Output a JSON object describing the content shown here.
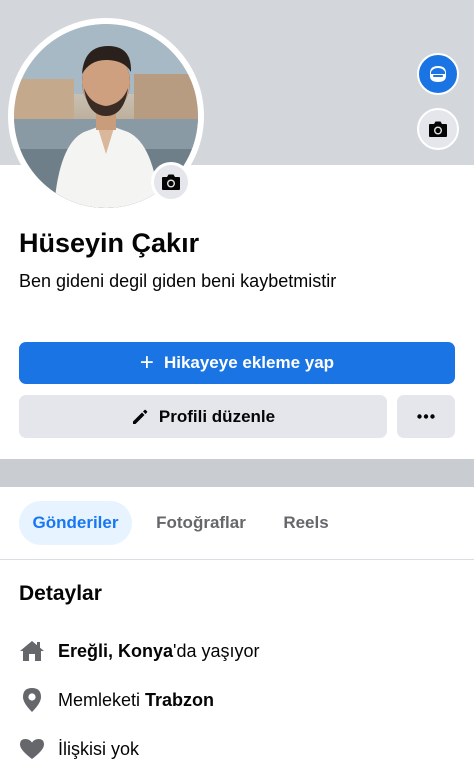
{
  "profile": {
    "name": "Hüseyin Çakır",
    "bio": "Ben gideni degil giden beni kaybetmistir"
  },
  "actions": {
    "add_story_label": "Hikayeye ekleme yap",
    "edit_profile_label": "Profili düzenle"
  },
  "tabs": [
    {
      "label": "Gönderiler",
      "active": true
    },
    {
      "label": "Fotoğraflar",
      "active": false
    },
    {
      "label": "Reels",
      "active": false
    }
  ],
  "details": {
    "title": "Detaylar",
    "lives_in": {
      "place": "Ereğli, Konya",
      "suffix": "'da yaşıyor",
      "icon": "home-icon"
    },
    "hometown": {
      "prefix": "Memleketi ",
      "place": "Trabzon",
      "icon": "location-pin-icon"
    },
    "relationship": {
      "text": "İlişkisi yok",
      "icon": "heart-icon"
    }
  },
  "colors": {
    "accent": "#1b74e4",
    "tab_active_bg": "#e7f3ff",
    "button_gray": "#e4e6eb",
    "icon_gray": "#65676b"
  }
}
